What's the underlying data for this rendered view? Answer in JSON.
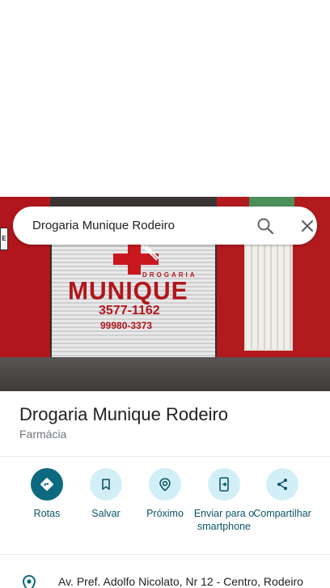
{
  "search": {
    "query": "Drogaria Munique Rodeiro"
  },
  "photo": {
    "storefront_brand": "MUNIQUE",
    "storefront_tag": "DROGARIA",
    "storefront_phone": "3577-1162",
    "storefront_whatsapp": "99980-3373",
    "sign_letter": "E"
  },
  "place": {
    "name": "Drogaria Munique Rodeiro",
    "category": "Farmácia"
  },
  "actions": [
    {
      "label": "Rotas",
      "icon": "directions-icon"
    },
    {
      "label": "Salvar",
      "icon": "bookmark-icon"
    },
    {
      "label": "Próximo",
      "icon": "nearby-icon"
    },
    {
      "label": "Enviar para o smartphone",
      "icon": "send-to-phone-icon"
    },
    {
      "label": "Compartilhar",
      "icon": "share-icon"
    }
  ],
  "address": {
    "text": "Av. Pref. Adolfo Nicolato, Nr 12 - Centro, Rodeiro"
  },
  "colors": {
    "accent": "#0b6a80",
    "action_bg": "#d2eff8",
    "action_text": "#0b5568"
  }
}
